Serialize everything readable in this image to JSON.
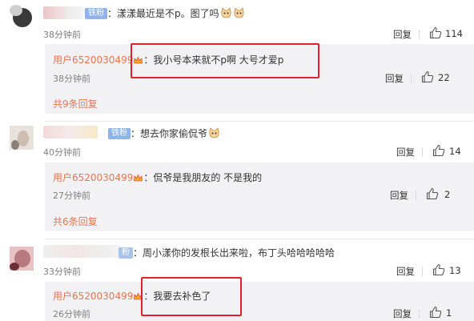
{
  "colors": {
    "accent": "#eb7350",
    "badge": "#8fb3ea",
    "highlight": "#e3202c"
  },
  "threads": [
    {
      "comment": {
        "badge": "铁粉",
        "text": "：漾漾最近是不p。图了吗",
        "time": "38分钟前",
        "reply": "回复",
        "likes": "114"
      },
      "reply": {
        "user": "用户6520030499",
        "text": "：我小号本来就不p啊 大号才爱p",
        "time": "38分钟前",
        "reply": "回复",
        "likes": "22"
      },
      "more": "共9条回复"
    },
    {
      "comment": {
        "badge": "铁粉",
        "text": "：想去你家偷侃爷",
        "time": "40分钟前",
        "reply": "回复",
        "likes": "14"
      },
      "reply": {
        "user": "用户6520030499",
        "text": "：侃爷是我朋友的 不是我的",
        "time": "27分钟前",
        "reply": "回复",
        "likes": "2"
      },
      "more": "共6条回复"
    },
    {
      "comment": {
        "badge": "粉",
        "text": "：周小漾你的发根长出来啦，布丁头哈哈哈哈哈",
        "time": "33分钟前",
        "reply": "回复",
        "likes": "13"
      },
      "reply": {
        "user": "用户6520030499",
        "text": "：我要去补色了",
        "time": "26分钟前",
        "reply": "回复",
        "likes": "1"
      }
    }
  ]
}
